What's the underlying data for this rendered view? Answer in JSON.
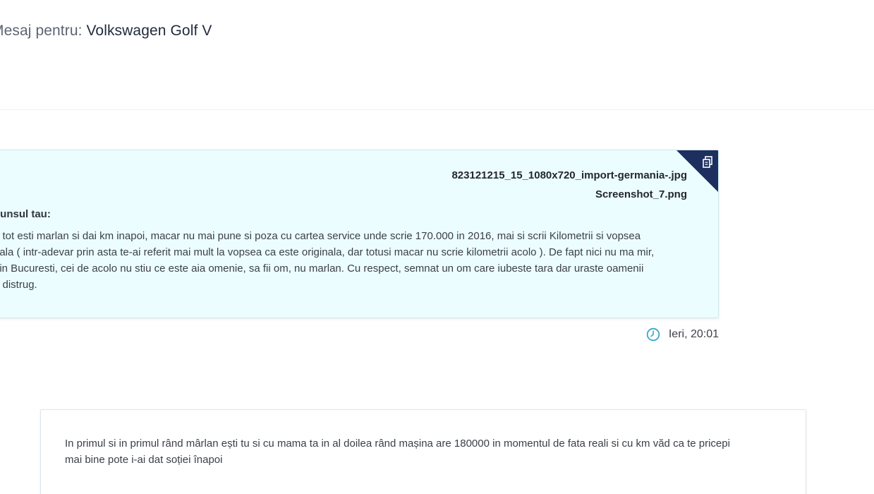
{
  "header": {
    "prefix": "Mesaj pentru: ",
    "title": "Volkswagen Golf V"
  },
  "sent_message": {
    "attachments": [
      "823121215_15_1080x720_import-germania-.jpg",
      "Screenshot_7.png"
    ],
    "reply_label": "punsul tau:",
    "body_lines": [
      "a tot esti marlan si dai km inapoi, macar nu mai pune si poza cu cartea service unde scrie 170.000 in 2016, mai si scrii Kilometrii si vopsea",
      "nala ( intr-adevar prin asta te-ai referit mai mult la vopsea ca este originala, dar totusi macar nu scrie kilometrii acolo ). De fapt nici nu ma mir,",
      "din Bucuresti, cei de acolo nu stiu ce este aia omenie, sa fii om, nu marlan. Cu respect, semnat un om care iubeste tara dar uraste oamenii",
      " o distrug."
    ],
    "timestamp": "Ieri, 20:01",
    "corner_icon": "copy-icon",
    "colors": {
      "bubble_bg": "#ecfdff",
      "corner": "#1c2f5e",
      "clock": "#3aa6c9"
    }
  },
  "received_message": {
    "body_lines": [
      "In primul si in primul rând mârlan ești tu si cu mama ta in al doilea rând mașina are 180000 in momentul de fata reali si cu km văd ca te pricepi",
      "mai bine pote i-ai dat soției înapoi"
    ]
  }
}
